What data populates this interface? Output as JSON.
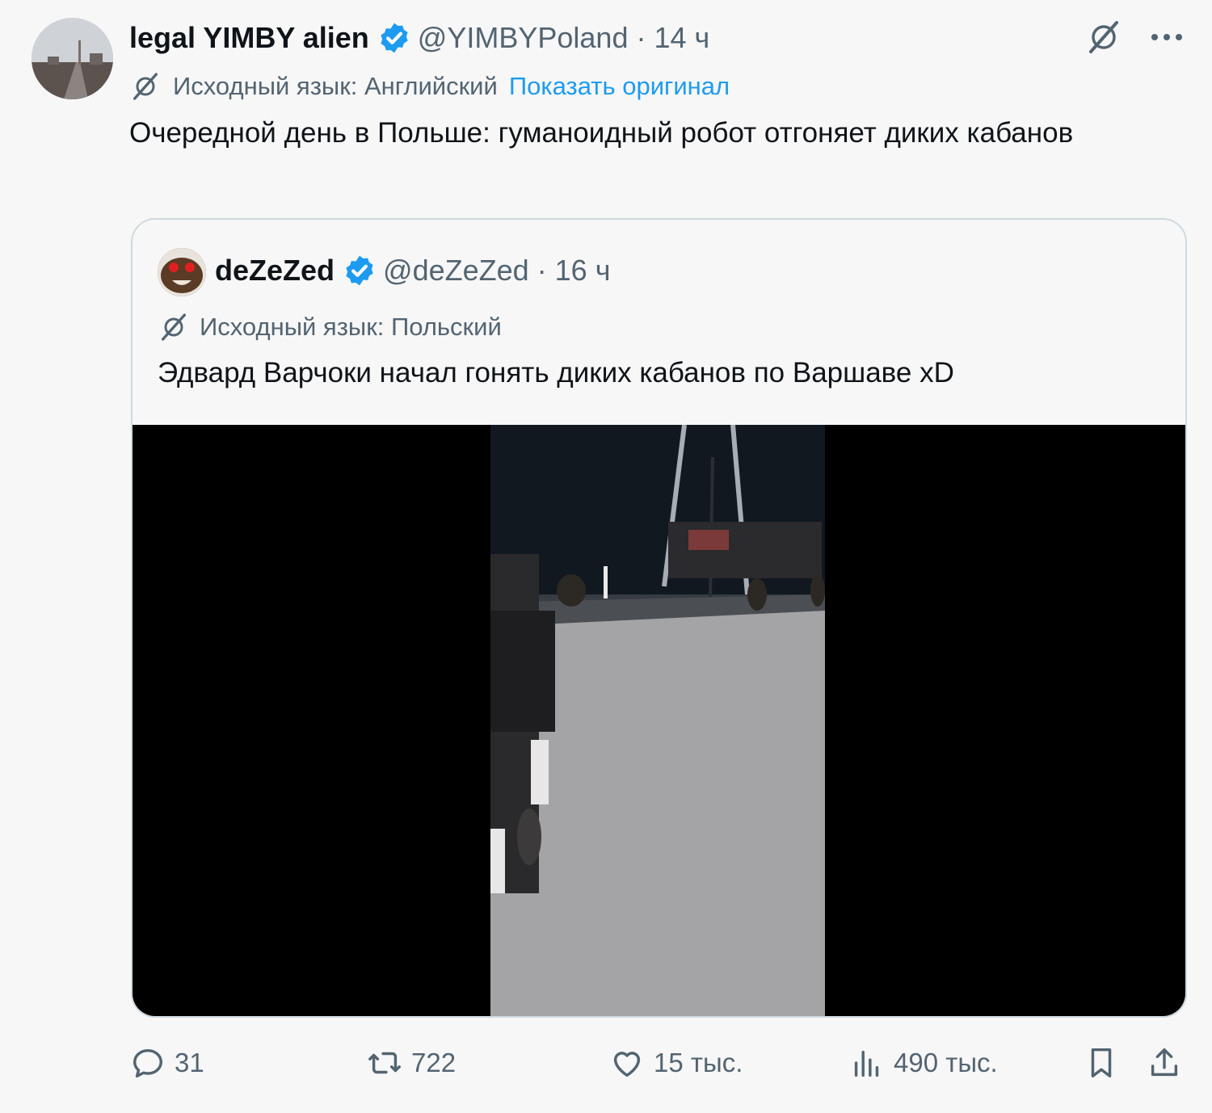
{
  "tweet": {
    "author_name": "legal YIMBY alien",
    "handle": "@YIMBYPoland",
    "time": "· 14 ч",
    "translation_label": "Исходный язык: Английский",
    "show_original": "Показать оригинал",
    "text": "Очередной день в Польше: гуманоидный робот отгоняет диких кабанов"
  },
  "quote": {
    "author_name": "deZeZed",
    "handle": "@deZeZed",
    "time": "· 16 ч",
    "translation_label": "Исходный язык: Польский",
    "text": "Эдвард Варчоки начал гонять диких кабанов по Варшаве xD"
  },
  "actions": {
    "replies": "31",
    "reposts": "722",
    "likes": "15 тыс.",
    "views": "490 тыс."
  },
  "colors": {
    "accent": "#1d9bf0",
    "muted": "#536471",
    "border": "#cfd9de",
    "background": "#f7f7f8"
  },
  "icons": [
    "verified-badge-icon",
    "grok-translate-icon",
    "more-icon",
    "reply-icon",
    "repost-icon",
    "like-icon",
    "views-icon",
    "bookmark-icon",
    "share-icon"
  ]
}
